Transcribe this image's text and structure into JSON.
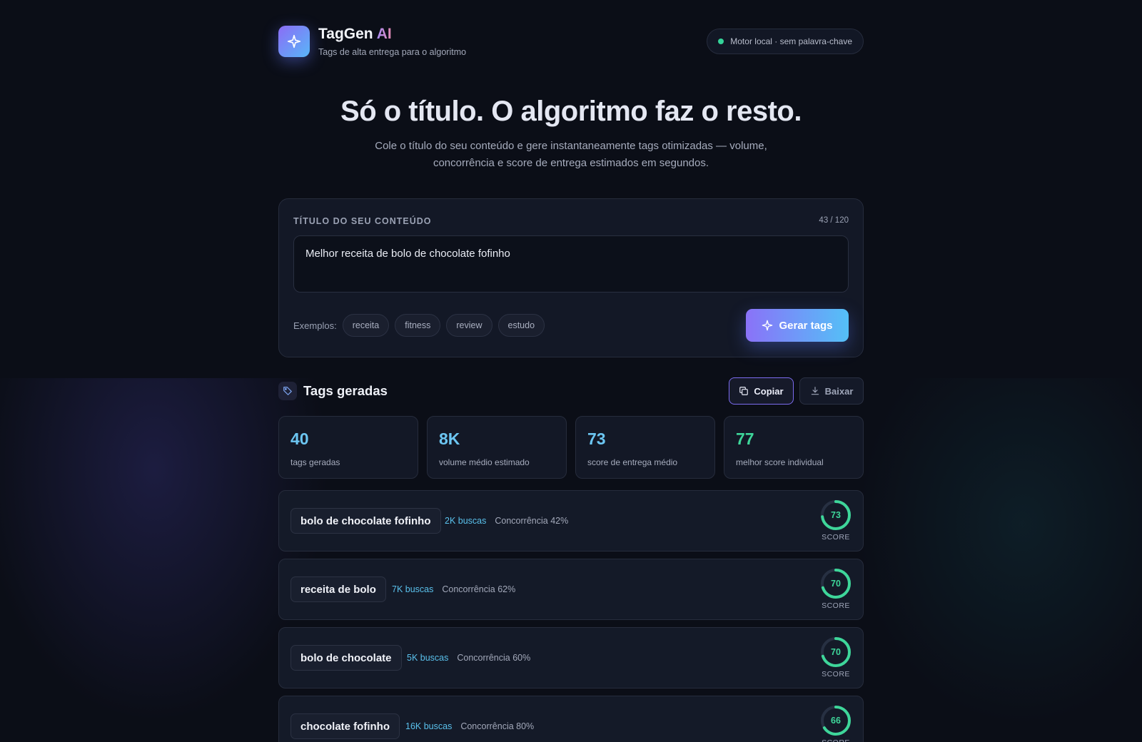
{
  "header": {
    "brand_name": "TagGen",
    "brand_ai": "AI",
    "subtitle": "Tags de alta entrega para o algoritmo",
    "status": "Motor local · sem palavra-chave"
  },
  "hero": {
    "title": "Só o título. O algoritmo faz o resto.",
    "description": "Cole o título do seu conteúdo e gere instantaneamente tags otimizadas — volume, concorrência e score de entrega estimados em segundos."
  },
  "input_card": {
    "label": "TÍTULO DO SEU CONTEÚDO",
    "count": "43 / 120",
    "value": "Melhor receita de bolo de chocolate fofinho",
    "examples_label": "Exemplos:",
    "examples": [
      "receita",
      "fitness",
      "review",
      "estudo"
    ],
    "generate_label": "Gerar tags"
  },
  "results": {
    "title": "Tags geradas",
    "copy_label": "Copiar",
    "download_label": "Baixar",
    "stats": [
      {
        "value": "40",
        "label": "tags geradas",
        "color": "#6cc6f2"
      },
      {
        "value": "8K",
        "label": "volume médio estimado",
        "color": "#6cc6f2"
      },
      {
        "value": "73",
        "label": "score de entrega médio",
        "color": "#6cc6f2"
      },
      {
        "value": "77",
        "label": "melhor score individual",
        "color": "#3ed69a"
      }
    ],
    "score_label": "SCORE",
    "tags": [
      {
        "tag": "bolo de chocolate fofinho",
        "searches": "2K buscas",
        "competition": "Concorrência 42%",
        "score": "73"
      },
      {
        "tag": "receita de bolo",
        "searches": "7K buscas",
        "competition": "Concorrência 62%",
        "score": "70"
      },
      {
        "tag": "bolo de chocolate",
        "searches": "5K buscas",
        "competition": "Concorrência 60%",
        "score": "70"
      },
      {
        "tag": "chocolate fofinho",
        "searches": "16K buscas",
        "competition": "Concorrência 80%",
        "score": "66"
      }
    ]
  },
  "colors": {
    "accent_start": "#8a72f8",
    "accent_end": "#54c0f7",
    "score_green": "#3ed69a",
    "status_dot": "#34d399"
  },
  "icons": {
    "logo": "sparkle-icon",
    "generate": "sparkle-icon",
    "results": "tag-icon",
    "copy": "copy-icon",
    "download": "download-icon"
  }
}
